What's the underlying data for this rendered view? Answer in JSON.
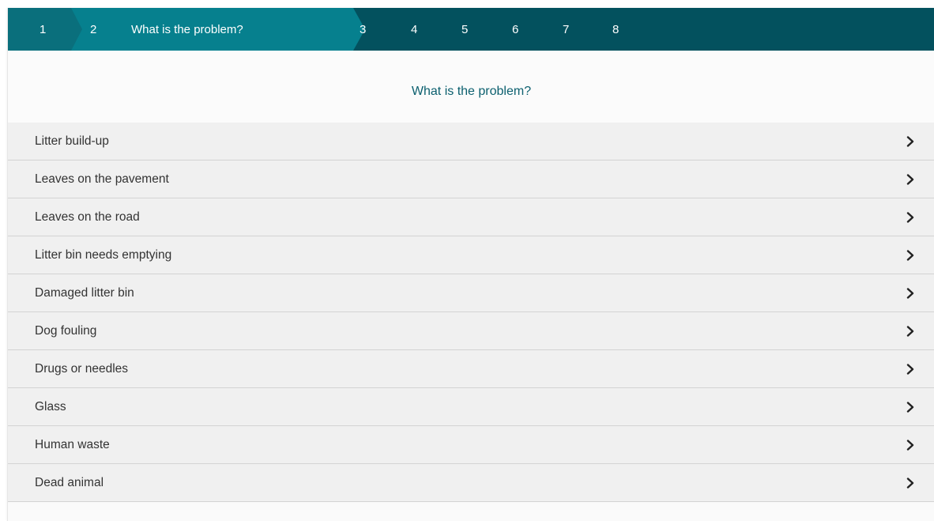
{
  "stepper": {
    "steps": [
      "1",
      "2",
      "3",
      "4",
      "5",
      "6",
      "7",
      "8"
    ],
    "active_step": "2",
    "active_label": "What is the problem?"
  },
  "page": {
    "title": "What is the problem?"
  },
  "options": [
    "Litter build-up",
    "Leaves on the pavement",
    "Leaves on the road",
    "Litter bin needs emptying",
    "Damaged litter bin",
    "Dog fouling",
    "Drugs or needles",
    "Glass",
    "Human waste",
    "Dead animal"
  ],
  "icons": {
    "row_arrow": "chevron-right-icon"
  },
  "colors": {
    "stepper_bg": "#03515e",
    "active_step_bg": "#06808e",
    "title_text": "#0b5f6e"
  }
}
